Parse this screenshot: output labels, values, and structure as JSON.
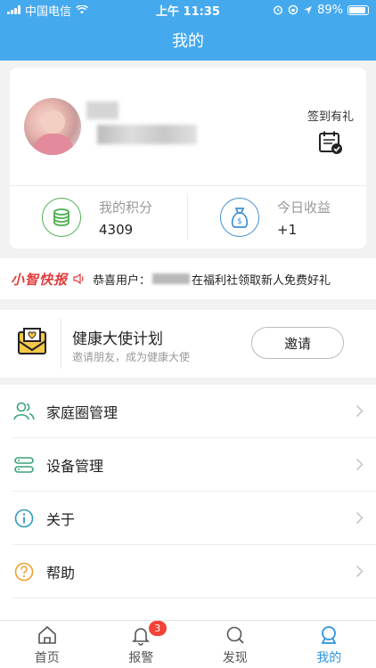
{
  "status_bar": {
    "carrier": "中国电信",
    "time": "上午 11:35",
    "battery": "89%"
  },
  "nav": {
    "title": "我的"
  },
  "profile": {
    "checkin_label": "签到有礼"
  },
  "stats": {
    "points_label": "我的积分",
    "points_value": "4309",
    "income_label": "今日收益",
    "income_value": "+1"
  },
  "news": {
    "brand": "小智快报",
    "prefix": "恭喜用户：",
    "message": "在福利社领取新人免费好礼"
  },
  "invite": {
    "title": "健康大使计划",
    "subtitle": "邀请朋友，成为健康大使",
    "button_label": "邀请"
  },
  "menu": [
    {
      "label": "家庭圈管理",
      "icon": "family-icon"
    },
    {
      "label": "设备管理",
      "icon": "device-icon"
    },
    {
      "label": "关于",
      "icon": "info-icon"
    },
    {
      "label": "帮助",
      "icon": "help-icon"
    }
  ],
  "tabs": [
    {
      "label": "首页",
      "icon": "home-icon"
    },
    {
      "label": "报警",
      "icon": "bell-icon",
      "badge": "3"
    },
    {
      "label": "发现",
      "icon": "search-icon"
    },
    {
      "label": "我的",
      "icon": "profile-icon",
      "active": true
    }
  ],
  "colors": {
    "primary": "#45a9ee",
    "tab_active": "#2b95e0",
    "points_green": "#4caf50",
    "income_blue": "#3f8fd6",
    "brand_red": "#e23b3b",
    "badge_red": "#f44336"
  }
}
